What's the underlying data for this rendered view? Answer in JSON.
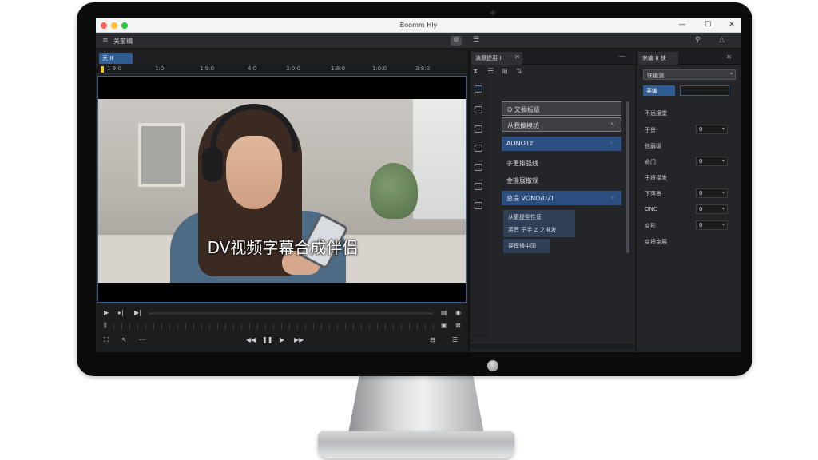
{
  "window": {
    "title": "Boomm Hly"
  },
  "menubar": {
    "label": "关窗编",
    "badge": "⊚"
  },
  "player": {
    "tab_label": "天 II",
    "ruler_ticks": [
      "1 9:0",
      "1:0",
      "1:9:0",
      "4:0",
      "3:0:0",
      "1:8:0",
      "1:0:0",
      "3:8:0"
    ],
    "subtitle": "DV视频字幕合成伴侣"
  },
  "middle_panel": {
    "tab_label": "演原提用 II",
    "items": [
      {
        "text": "O 又搁板级",
        "style": "light"
      },
      {
        "text": "从我搞模坊",
        "style": "light"
      },
      {
        "text": "AONO1z",
        "style": "blue"
      },
      {
        "text": "字更排强线",
        "style": "plain"
      },
      {
        "text": "金提展撤规",
        "style": "plain"
      },
      {
        "text": "总提 VONO/UZI",
        "style": "blue"
      },
      {
        "text": "从更提型性证",
        "style": "mid"
      },
      {
        "text": "英音 子半 Z 之准发",
        "style": "mid"
      },
      {
        "text": "要模换中国",
        "style": "mid"
      }
    ]
  },
  "right_panel": {
    "tab_label": "来编 II 扶",
    "select_value": "联编测",
    "input_chip": "乘编",
    "section_header": "不远接堂",
    "props": [
      {
        "label": "于景",
        "value": "0"
      },
      {
        "label": "他弱级",
        "value": ""
      },
      {
        "label": "命门",
        "value": "0"
      },
      {
        "label": "于将接发",
        "value": ""
      },
      {
        "label": "下落景",
        "value": "0"
      },
      {
        "label": "ONC",
        "value": "0"
      },
      {
        "label": "变形",
        "value": "0"
      },
      {
        "label": "变将金展",
        "value": ""
      }
    ]
  }
}
